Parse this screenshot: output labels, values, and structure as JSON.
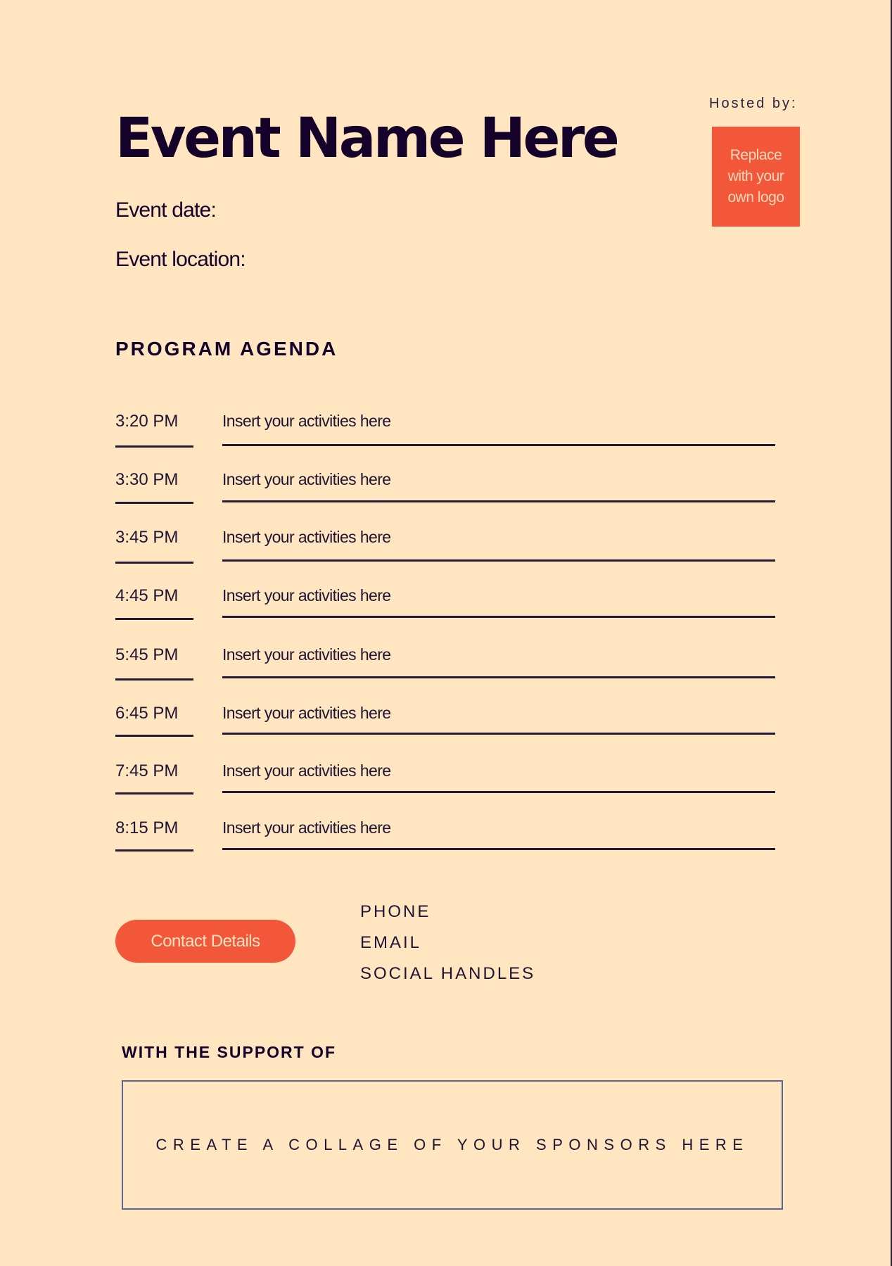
{
  "header": {
    "title": "Event Name Here",
    "event_date_label": "Event date:",
    "event_location_label": "Event location:"
  },
  "host": {
    "label": "Hosted by:",
    "logo_placeholder": "Replace with your own logo"
  },
  "agenda": {
    "heading": "PROGRAM AGENDA",
    "items": [
      {
        "time": "3:20 PM",
        "activity": "Insert your activities here"
      },
      {
        "time": "3:30 PM",
        "activity": "Insert your activities here"
      },
      {
        "time": "3:45 PM",
        "activity": "Insert your activities here"
      },
      {
        "time": "4:45 PM",
        "activity": "Insert your activities here"
      },
      {
        "time": "5:45 PM",
        "activity": "Insert your activities here"
      },
      {
        "time": "6:45 PM",
        "activity": "Insert your activities here"
      },
      {
        "time": "7:45 PM",
        "activity": "Insert your activities here"
      },
      {
        "time": "8:15 PM",
        "activity": "Insert your activities here"
      }
    ]
  },
  "contact": {
    "button_label": "Contact Details",
    "items": [
      "PHONE",
      "EMAIL",
      "SOCIAL HANDLES"
    ]
  },
  "sponsors": {
    "heading": "WITH THE SUPPORT OF",
    "placeholder": "CREATE A COLLAGE OF YOUR SPONSORS HERE"
  },
  "colors": {
    "background": "#ffe6c0",
    "accent": "#f2573a",
    "text": "#14022b",
    "box_border": "#56679a"
  }
}
